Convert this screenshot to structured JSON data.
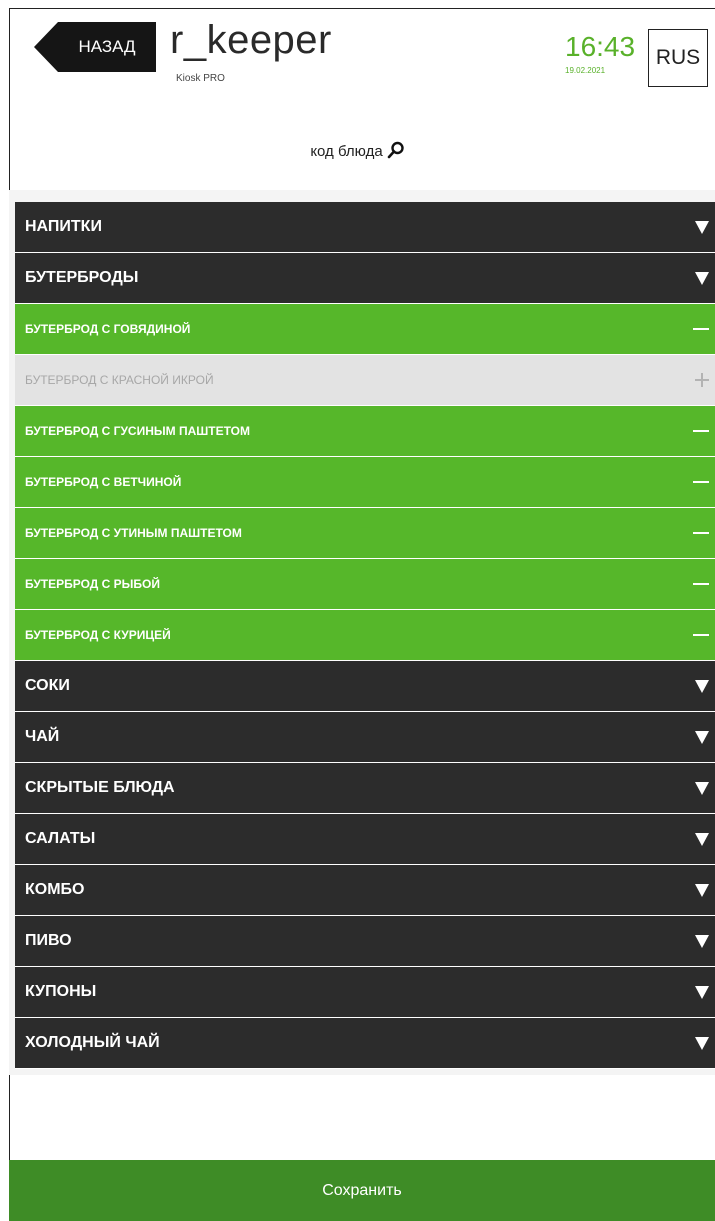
{
  "header": {
    "back_label": "НАЗАД",
    "brand": "r_keeper",
    "brand_sub": "Kiosk PRO",
    "time": "16:43",
    "date": "19.02.2021",
    "language": "RUS"
  },
  "search": {
    "label": "код блюда",
    "icon": "search-icon"
  },
  "menu": [
    {
      "type": "category",
      "label": "НАПИТКИ",
      "icon": "triangle-down-icon"
    },
    {
      "type": "category",
      "label": "БУТЕРБРОДЫ",
      "icon": "triangle-down-icon"
    },
    {
      "type": "item",
      "selected": true,
      "label": "БУТЕРБРОД С ГОВЯДИНОЙ",
      "icon": "minus-icon"
    },
    {
      "type": "item",
      "selected": false,
      "label": "БУТЕРБРОД С КРАСНОЙ ИКРОЙ",
      "icon": "plus-icon"
    },
    {
      "type": "item",
      "selected": true,
      "label": "БУТЕРБРОД С ГУСИНЫМ ПАШТЕТОМ",
      "icon": "minus-icon"
    },
    {
      "type": "item",
      "selected": true,
      "label": "БУТЕРБРОД С ВЕТЧИНОЙ",
      "icon": "minus-icon"
    },
    {
      "type": "item",
      "selected": true,
      "label": "БУТЕРБРОД С УТИНЫМ ПАШТЕТОМ",
      "icon": "minus-icon"
    },
    {
      "type": "item",
      "selected": true,
      "label": "БУТЕРБРОД С РЫБОЙ",
      "icon": "minus-icon"
    },
    {
      "type": "item",
      "selected": true,
      "label": "БУТЕРБРОД С КУРИЦЕЙ",
      "icon": "minus-icon"
    },
    {
      "type": "category",
      "label": "СОКИ",
      "icon": "triangle-down-icon"
    },
    {
      "type": "category",
      "label": "ЧАЙ",
      "icon": "triangle-down-icon"
    },
    {
      "type": "category",
      "label": "СКРЫТЫЕ БЛЮДА",
      "icon": "triangle-down-icon"
    },
    {
      "type": "category",
      "label": "САЛАТЫ",
      "icon": "triangle-down-icon"
    },
    {
      "type": "category",
      "label": "КОМБО",
      "icon": "triangle-down-icon"
    },
    {
      "type": "category",
      "label": "ПИВО",
      "icon": "triangle-down-icon"
    },
    {
      "type": "category",
      "label": "КУПОНЫ",
      "icon": "triangle-down-icon"
    },
    {
      "type": "category",
      "label": "ХОЛОДНЫЙ ЧАЙ",
      "icon": "triangle-down-icon"
    }
  ],
  "footer": {
    "save_label": "Сохранить"
  },
  "colors": {
    "accent": "#56b72a",
    "clock": "#59b12a",
    "category_bg": "#2c2c2c",
    "disabled_bg": "#e3e3e3",
    "footer_bg": "#3e8c26"
  }
}
